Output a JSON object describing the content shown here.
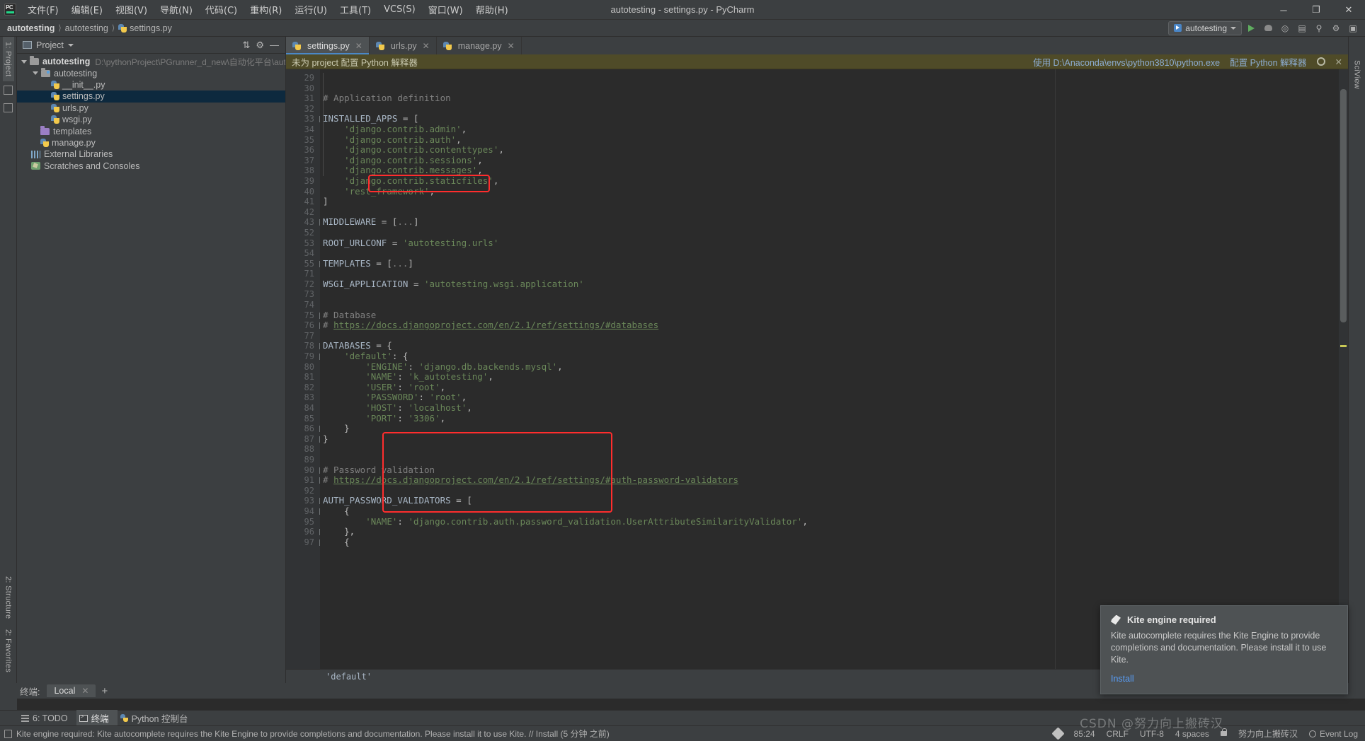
{
  "window": {
    "title": "autotesting - settings.py - PyCharm",
    "logo": "pycharm-logo",
    "controls": {
      "minimize": "─",
      "maximize": "❐",
      "close": "✕"
    }
  },
  "menubar": {
    "items": [
      {
        "label": "文件(F)",
        "name": "menu-file"
      },
      {
        "label": "编辑(E)",
        "name": "menu-edit"
      },
      {
        "label": "视图(V)",
        "name": "menu-view"
      },
      {
        "label": "导航(N)",
        "name": "menu-navigate"
      },
      {
        "label": "代码(C)",
        "name": "menu-code"
      },
      {
        "label": "重构(R)",
        "name": "menu-refactor"
      },
      {
        "label": "运行(U)",
        "name": "menu-run"
      },
      {
        "label": "工具(T)",
        "name": "menu-tools"
      },
      {
        "label": "VCS(S)",
        "name": "menu-vcs"
      },
      {
        "label": "窗口(W)",
        "name": "menu-window"
      },
      {
        "label": "帮助(H)",
        "name": "menu-help"
      }
    ]
  },
  "breadcrumb": {
    "project": "autotesting",
    "module": "autotesting",
    "file": "settings.py"
  },
  "run_config": {
    "label": "autotesting",
    "icons": [
      "run-icon",
      "debug-icon",
      "coverage-icon",
      "profile-icon",
      "search-everywhere-icon",
      "settings-icon"
    ]
  },
  "left_strip": {
    "tabs": [
      {
        "label": "1: Project",
        "name": "tool-window-project"
      }
    ],
    "bottom_tabs": [
      {
        "label": "2: Structure",
        "name": "tool-window-structure"
      },
      {
        "label": "2: Favorites",
        "name": "tool-window-favorites"
      }
    ]
  },
  "right_strip": {
    "tabs": [
      {
        "label": "SciView",
        "name": "tool-window-sciview"
      }
    ]
  },
  "project_panel": {
    "header": "Project",
    "tree": [
      {
        "label": "autotesting",
        "path": "D:\\pythonProject\\PGrunner_d_new\\自动化平台\\autotesting",
        "depth": 0,
        "icon": "folder-icon",
        "bold": true,
        "expanded": true,
        "selected": false
      },
      {
        "label": "autotesting",
        "path": "",
        "depth": 1,
        "icon": "source-folder-icon",
        "bold": false,
        "expanded": true,
        "selected": false
      },
      {
        "label": "__init__.py",
        "path": "",
        "depth": 2,
        "icon": "python-file-icon",
        "bold": false,
        "expanded": null,
        "selected": false
      },
      {
        "label": "settings.py",
        "path": "",
        "depth": 2,
        "icon": "python-file-icon",
        "bold": false,
        "expanded": null,
        "selected": true
      },
      {
        "label": "urls.py",
        "path": "",
        "depth": 2,
        "icon": "python-file-icon",
        "bold": false,
        "expanded": null,
        "selected": false
      },
      {
        "label": "wsgi.py",
        "path": "",
        "depth": 2,
        "icon": "python-file-icon",
        "bold": false,
        "expanded": null,
        "selected": false
      },
      {
        "label": "templates",
        "path": "",
        "depth": 1,
        "icon": "template-folder-icon",
        "bold": false,
        "expanded": null,
        "selected": false
      },
      {
        "label": "manage.py",
        "path": "",
        "depth": 1,
        "icon": "python-file-icon",
        "bold": false,
        "expanded": null,
        "selected": false
      },
      {
        "label": "External Libraries",
        "path": "",
        "depth": 0,
        "icon": "libraries-icon",
        "bold": false,
        "expanded": null,
        "selected": false
      },
      {
        "label": "Scratches and Consoles",
        "path": "",
        "depth": 0,
        "icon": "scratches-icon",
        "bold": false,
        "expanded": null,
        "selected": false
      }
    ]
  },
  "editor": {
    "tabs": [
      {
        "label": "settings.py",
        "active": true,
        "name": "editor-tab-settings"
      },
      {
        "label": "urls.py",
        "active": false,
        "name": "editor-tab-urls"
      },
      {
        "label": "manage.py",
        "active": false,
        "name": "editor-tab-manage"
      }
    ],
    "banner": {
      "message": "未为 project 配置 Python 解释器",
      "interpreter_link": "使用 D:\\Anaconda\\envs\\python3810\\python.exe",
      "configure_link": "配置 Python 解释器",
      "close": "✕"
    },
    "breadcrumb_bottom": "'default'",
    "lines": [
      {
        "num": 29,
        "code": ""
      },
      {
        "num": 30,
        "code": ""
      },
      {
        "num": 31,
        "code": "# Application definition",
        "cls": "com"
      },
      {
        "num": 32,
        "code": ""
      },
      {
        "num": 33,
        "code": "INSTALLED_APPS = [",
        "fold": true
      },
      {
        "num": 34,
        "code": "    'django.contrib.admin',"
      },
      {
        "num": 35,
        "code": "    'django.contrib.auth',"
      },
      {
        "num": 36,
        "code": "    'django.contrib.contenttypes',"
      },
      {
        "num": 37,
        "code": "    'django.contrib.sessions',"
      },
      {
        "num": 38,
        "code": "    'django.contrib.messages',"
      },
      {
        "num": 39,
        "code": "    'django.contrib.staticfiles',"
      },
      {
        "num": 40,
        "code": "    'rest_framework',"
      },
      {
        "num": 41,
        "code": "]"
      },
      {
        "num": 42,
        "code": ""
      },
      {
        "num": 43,
        "code": "MIDDLEWARE = [...]",
        "fold": true
      },
      {
        "num": 52,
        "code": ""
      },
      {
        "num": 53,
        "code": "ROOT_URLCONF = 'autotesting.urls'"
      },
      {
        "num": 54,
        "code": ""
      },
      {
        "num": 55,
        "code": "TEMPLATES = [...]",
        "fold": true
      },
      {
        "num": 71,
        "code": ""
      },
      {
        "num": 72,
        "code": "WSGI_APPLICATION = 'autotesting.wsgi.application'"
      },
      {
        "num": 73,
        "code": ""
      },
      {
        "num": 74,
        "code": ""
      },
      {
        "num": 75,
        "code": "# Database",
        "fold": true
      },
      {
        "num": 76,
        "code": "# https://docs.djangoproject.com/en/2.1/ref/settings/#databases",
        "fold": true
      },
      {
        "num": 77,
        "code": ""
      },
      {
        "num": 78,
        "code": "DATABASES = {",
        "fold": true
      },
      {
        "num": 79,
        "code": "    'default': {",
        "fold": true
      },
      {
        "num": 80,
        "code": "        'ENGINE': 'django.db.backends.mysql',"
      },
      {
        "num": 81,
        "code": "        'NAME': 'k_autotesting',"
      },
      {
        "num": 82,
        "code": "        'USER': 'root',"
      },
      {
        "num": 83,
        "code": "        'PASSWORD': 'root',"
      },
      {
        "num": 84,
        "code": "        'HOST': 'localhost',"
      },
      {
        "num": 85,
        "code": "        'PORT': '3306',"
      },
      {
        "num": 86,
        "code": "    }",
        "fold": true
      },
      {
        "num": 87,
        "code": "}",
        "fold": true
      },
      {
        "num": 88,
        "code": ""
      },
      {
        "num": 89,
        "code": ""
      },
      {
        "num": 90,
        "code": "# Password validation",
        "fold": true
      },
      {
        "num": 91,
        "code": "# https://docs.djangoproject.com/en/2.1/ref/settings/#auth-password-validators",
        "fold": true
      },
      {
        "num": 92,
        "code": ""
      },
      {
        "num": 93,
        "code": "AUTH_PASSWORD_VALIDATORS = [",
        "fold": true
      },
      {
        "num": 94,
        "code": "    {",
        "fold": true
      },
      {
        "num": 95,
        "code": "        'NAME': 'django.contrib.auth.password_validation.UserAttributeSimilarityValidator',"
      },
      {
        "num": 96,
        "code": "    },",
        "fold": true
      },
      {
        "num": 97,
        "code": "    {",
        "fold": true
      }
    ]
  },
  "terminal": {
    "label": "终端:",
    "tab": "Local",
    "close": "✕",
    "add": "+"
  },
  "bottom_tabs": [
    {
      "label": "6: TODO",
      "icon": "todo-icon",
      "active": false,
      "name": "tool-tab-todo"
    },
    {
      "label": "终端",
      "icon": "terminal-icon",
      "active": true,
      "name": "tool-tab-terminal"
    },
    {
      "label": "Python 控制台",
      "icon": "python-console-icon",
      "active": false,
      "name": "tool-tab-python-console"
    }
  ],
  "statusbar": {
    "message": "Kite engine required: Kite autocomplete requires the Kite Engine to provide completions and documentation. Please install it to use Kite. // Install (5 分钟 之前)",
    "caret": "85:24",
    "line_sep": "CRLF",
    "encoding": "UTF-8",
    "indent": "4 spaces",
    "branch": "努力向上搬砖汉",
    "event_log": "Event Log"
  },
  "kite_popup": {
    "title": "Kite engine required",
    "body": "Kite autocomplete requires the Kite Engine to provide completions and documentation. Please install it to use Kite.",
    "action": "Install"
  },
  "watermark": "CSDN @努力向上搬砖汉",
  "colors": {
    "accent": "#4a88c7",
    "banner_bg": "#4f4b28",
    "highlight_red": "#ff2d2d",
    "selection": "#0d293e",
    "editor_bg": "#2b2b2b",
    "chrome_bg": "#3c3f41"
  }
}
